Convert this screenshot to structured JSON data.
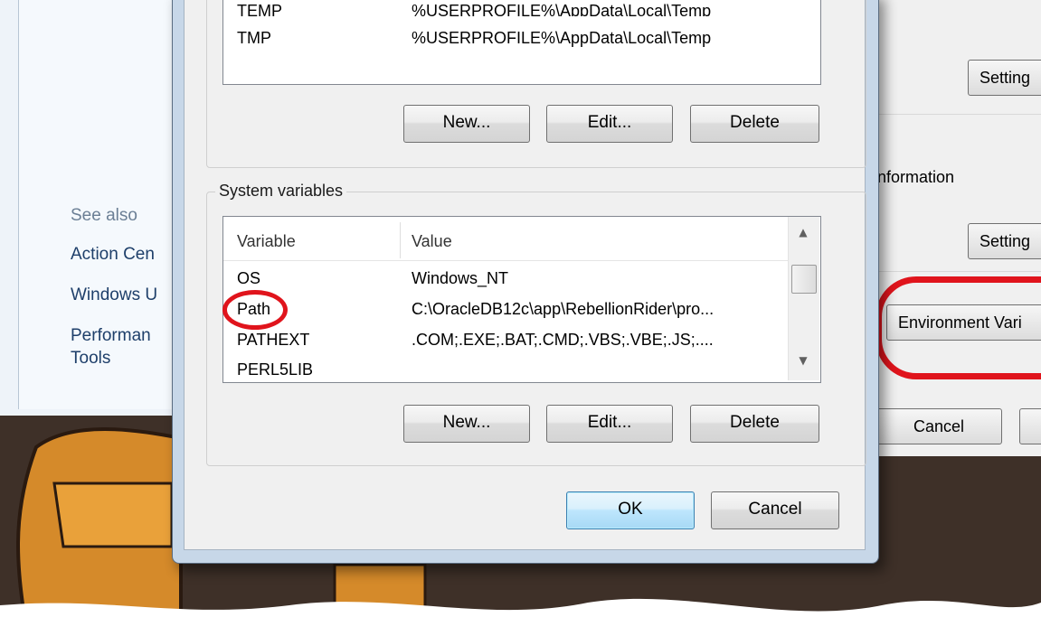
{
  "control_panel": {
    "see_also": "See also",
    "links": [
      "Action Cen",
      "Windows U",
      "Performan",
      "Tools"
    ]
  },
  "system_properties": {
    "settings_button_1": "Setting",
    "settings_button_2": "Setting",
    "info_text": "information",
    "env_button": "Environment Vari",
    "cancel_button": "Cancel"
  },
  "dialog": {
    "user_vars": {
      "rows": [
        {
          "variable": "TEMP",
          "value": "%USERPROFILE%\\AppData\\Local\\Temp"
        },
        {
          "variable": "TMP",
          "value": "%USERPROFILE%\\AppData\\Local\\Temp"
        }
      ],
      "new_label": "New...",
      "edit_label": "Edit...",
      "delete_label": "Delete"
    },
    "system_vars": {
      "group_label": "System variables",
      "col_variable": "Variable",
      "col_value": "Value",
      "rows": [
        {
          "variable": "OS",
          "value": "Windows_NT"
        },
        {
          "variable": "Path",
          "value": "C:\\OracleDB12c\\app\\RebellionRider\\pro..."
        },
        {
          "variable": "PATHEXT",
          "value": ".COM;.EXE;.BAT;.CMD;.VBS;.VBE;.JS;...."
        },
        {
          "variable": "PERL5LIB",
          "value": ""
        }
      ],
      "new_label": "New...",
      "edit_label": "Edit...",
      "delete_label": "Delete"
    },
    "ok_label": "OK",
    "cancel_label": "Cancel"
  },
  "icons": {
    "scroll_up": "▲",
    "scroll_down": "▼"
  },
  "colors": {
    "annotation_red": "#e0141c",
    "wallpaper": "#3e3028"
  }
}
